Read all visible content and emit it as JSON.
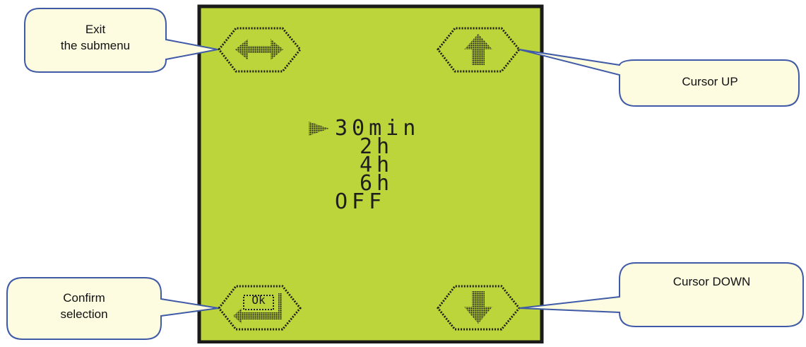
{
  "screen": {
    "bg_color": "#bbd53a",
    "border_color": "#1a1a1a",
    "cursor_marker": "▶",
    "menu_items": [
      "30min",
      "2h",
      "4h",
      "6h",
      "OFF"
    ],
    "selected_index": 0
  },
  "buttons": {
    "exit": {
      "icon": "left-right-arrows-icon"
    },
    "up": {
      "icon": "arrow-up-icon"
    },
    "ok": {
      "icon": "ok-enter-icon",
      "label": "Ok"
    },
    "down": {
      "icon": "arrow-down-icon"
    }
  },
  "callouts": {
    "exit": {
      "line1": "Exit",
      "line2": "the submenu"
    },
    "up": {
      "text": "Cursor UP"
    },
    "confirm": {
      "line1": "Confirm",
      "line2": "selection"
    },
    "down": {
      "text": "Cursor DOWN"
    }
  },
  "colors": {
    "callout_fill": "#fdfbe0",
    "callout_stroke": "#3f5aa7",
    "dots": "#1e1e1e"
  }
}
